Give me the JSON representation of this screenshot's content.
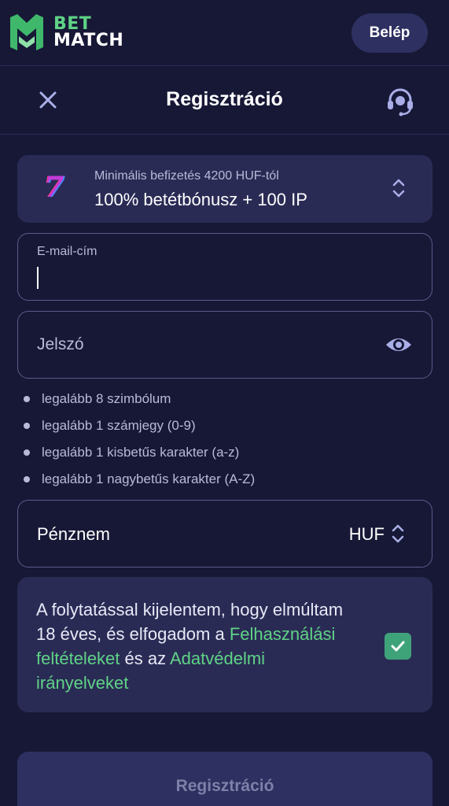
{
  "header": {
    "logo_line1": "BET",
    "logo_line2": "MATCH",
    "login_label": "Belép"
  },
  "titlebar": {
    "title": "Regisztráció",
    "close_icon": "close-icon",
    "support_icon": "headset-icon"
  },
  "bonus": {
    "icon_glyph": "7",
    "subtitle": "Minimális befizetés 4200 HUF-tól",
    "title": "100% betétbónusz + 100 IP"
  },
  "email": {
    "label": "E-mail-cím",
    "value": ""
  },
  "password": {
    "placeholder": "Jelszó",
    "toggle_icon": "eye-icon"
  },
  "password_rules": [
    "legalább 8 szimbólum",
    "legalább 1 számjegy (0-9)",
    "legalább 1 kisbetűs karakter (a-z)",
    "legalább 1 nagybetűs karakter (A-Z)"
  ],
  "currency": {
    "label": "Pénznem",
    "value": "HUF"
  },
  "terms": {
    "text_before": "A folytatással kijelentem, hogy elmúltam 18 éves, és elfogadom a ",
    "link_terms": "Felhasználási feltételeket",
    "text_middle": " és az ",
    "link_privacy": "Adatvédelmi irányelveket",
    "checked": true
  },
  "submit_label": "Regisztráció",
  "colors": {
    "background": "#171836",
    "card": "#2a2b55",
    "accent_green": "#5fd386",
    "checkbox_green": "#3fa37a",
    "muted_text": "#b8bad8"
  }
}
